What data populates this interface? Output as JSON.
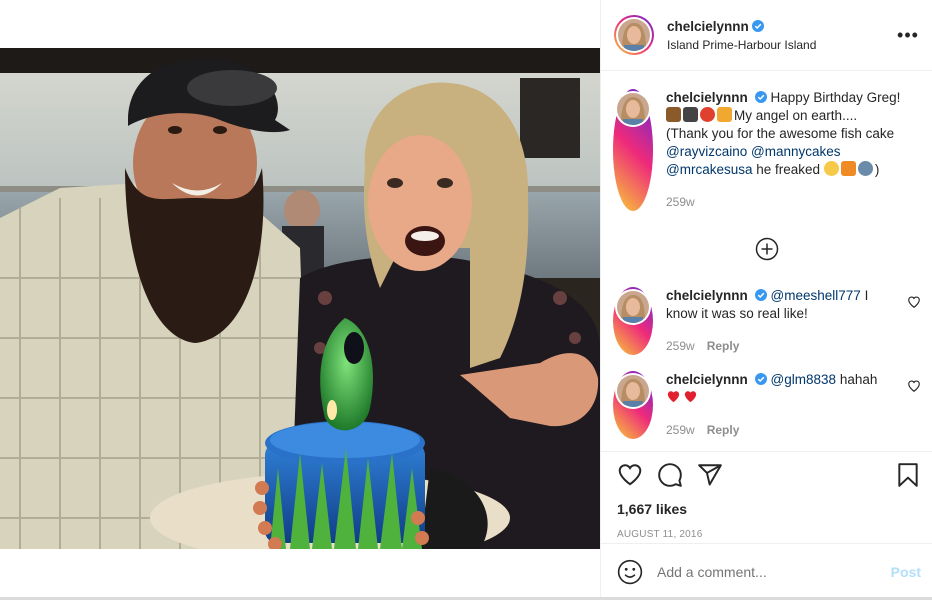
{
  "post": {
    "username": "chelcielynnn",
    "location": "Island Prime-Harbour Island",
    "more_icon": "more-horizontal-icon"
  },
  "caption": {
    "username": "chelcielynnn",
    "text_1": "Happy Birthday Greg!",
    "text_2": "My angel on earth....",
    "text_3": "(Thank you for the awesome fish cake",
    "mention_1": "@rayvizcaino",
    "mention_2": "@mannycakes",
    "mention_3": "@mrcakesusa",
    "text_4": "he freaked",
    "text_5": ")",
    "time": "259w"
  },
  "comments": [
    {
      "username": "chelcielynnn",
      "mention": "@meeshell777",
      "text": "I know it was so real like!",
      "time": "259w",
      "reply": "Reply"
    },
    {
      "username": "chelcielynnn",
      "mention": "@glm8838",
      "text": "hahah",
      "time": "259w",
      "reply": "Reply"
    }
  ],
  "actions": {
    "likes": "1,667 likes",
    "date": "AUGUST 11, 2016"
  },
  "add_comment": {
    "placeholder": "Add a comment...",
    "post_label": "Post"
  },
  "colors": {
    "link": "#00376b",
    "verified": "#3897f0",
    "post_button": "#b2dffc",
    "heart_emoji": "#e0202e"
  }
}
